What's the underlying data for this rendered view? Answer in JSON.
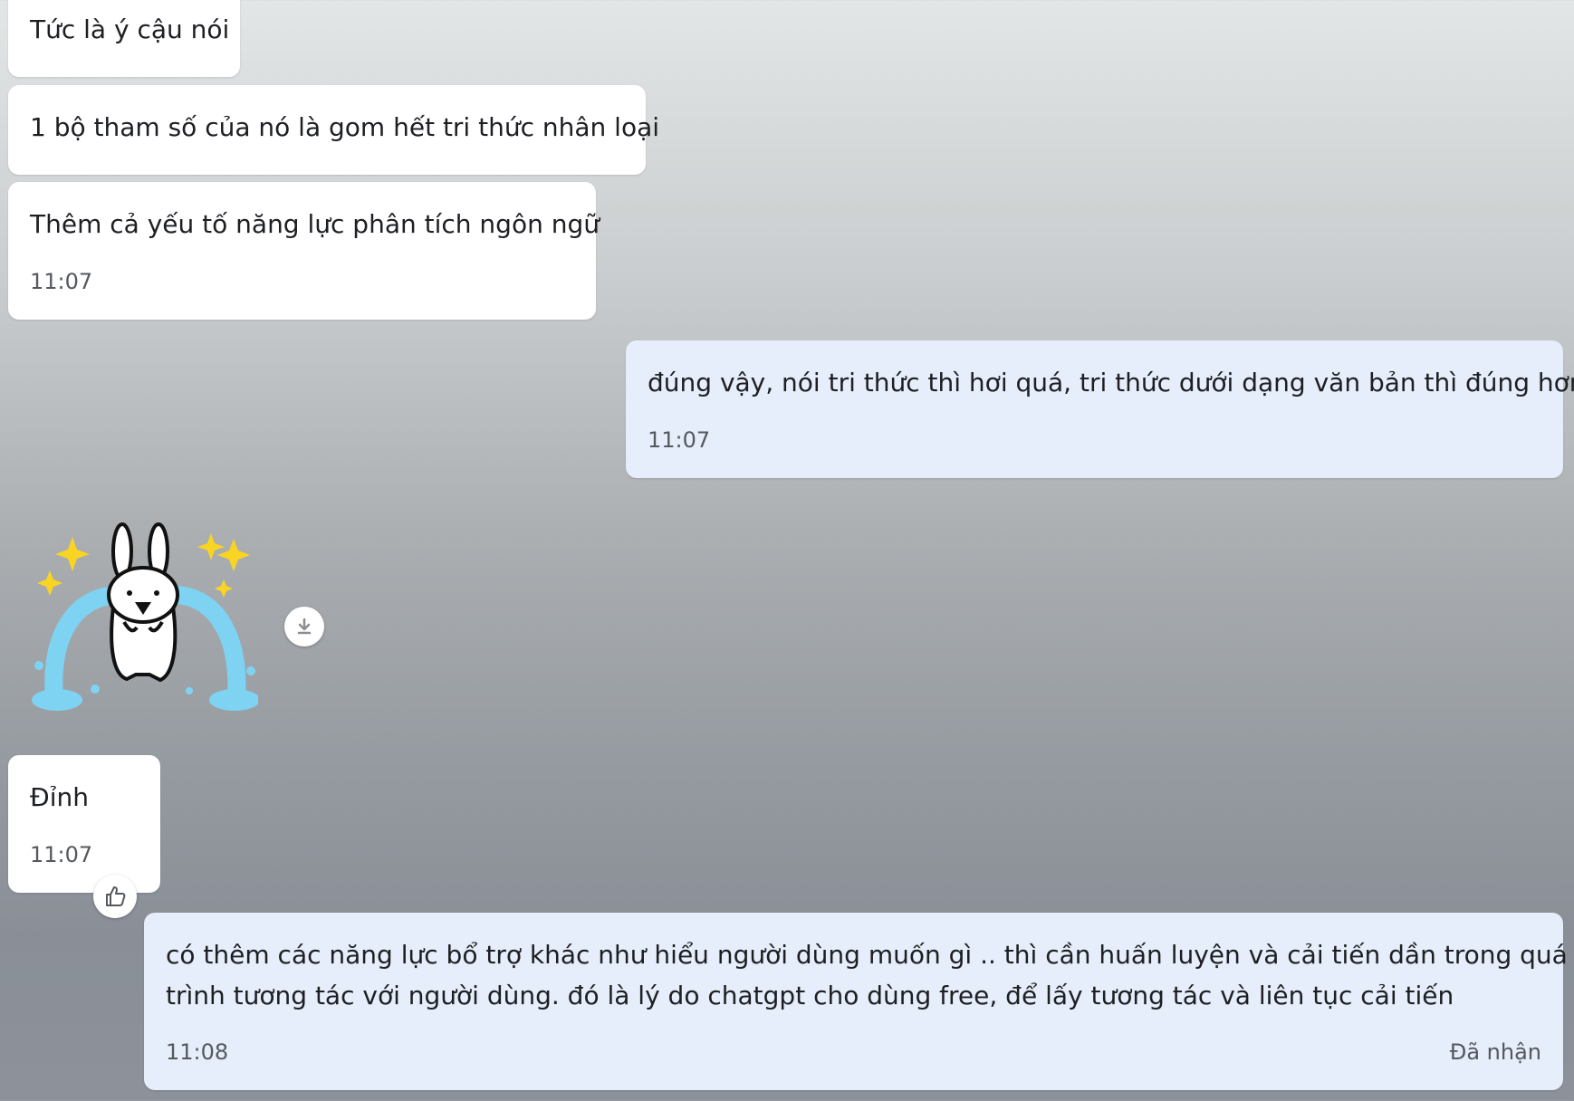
{
  "messages": [
    {
      "text": "Tức là ý cậu nói"
    },
    {
      "text": "1 bộ tham số của nó là gom hết tri thức nhân loại"
    },
    {
      "text": "Thêm cả yếu tố năng lực phân tích ngôn ngữ",
      "time": "11:07"
    },
    {
      "text": "đúng vậy, nói tri thức thì hơi quá, tri thức dưới dạng văn bản thì đúng hơn",
      "time": "11:07"
    },
    {
      "text": "Đỉnh",
      "time": "11:07"
    },
    {
      "text_line1": "có thêm các năng lực bổ trợ khác như hiểu người dùng muốn gì .. thì cần huấn luyện và cải tiến dần trong quá",
      "text_line2": "trình tương tác với người dùng. đó là lý do chatgpt cho dùng free, để lấy tương tác và liên tục cải tiến",
      "time": "11:08",
      "status": "Đã nhận"
    }
  ],
  "sticker": {
    "icon": "crying-rabbit-sticker"
  },
  "icons": {
    "download": "download-icon",
    "reaction": "thumbs-up-icon"
  },
  "colors": {
    "incoming_bubble": "#ffffff",
    "outgoing_bubble": "#e6eefb"
  }
}
